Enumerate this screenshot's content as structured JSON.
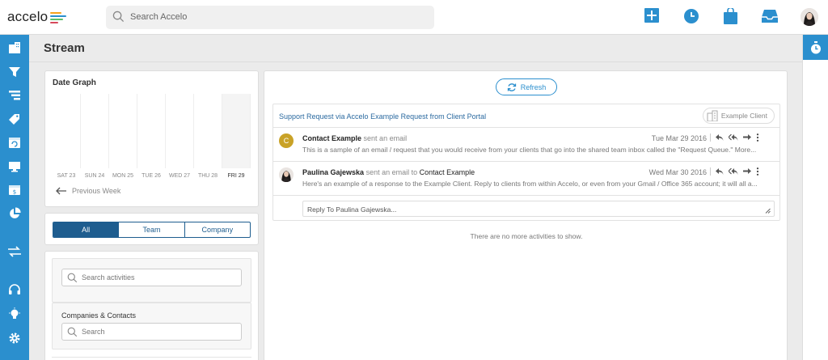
{
  "app": {
    "logo_text": "accelo",
    "search_placeholder": "Search Accelo"
  },
  "page": {
    "title": "Stream"
  },
  "date_graph": {
    "title": "Date Graph",
    "days": [
      "SAT 23",
      "SUN 24",
      "MON 25",
      "TUE 26",
      "WED 27",
      "THU 28",
      "FRI 29"
    ],
    "prev_label": "Previous Week"
  },
  "filter_tabs": [
    "All",
    "Team",
    "Company"
  ],
  "search_activities_placeholder": "Search activities",
  "companies_contacts": {
    "title": "Companies & Contacts",
    "search_placeholder": "Search"
  },
  "stream": {
    "refresh_label": "Refresh",
    "thread_title": "Support Request via Accelo Example Request from Client Portal",
    "client_tag": "Example Client",
    "messages": [
      {
        "avatar_letter": "C",
        "from": "Contact Example",
        "verb": "sent an email",
        "to": "",
        "date": "Tue Mar 29 2016",
        "body": "This is a sample of an email / request that you would receive from your clients that go into the shared team inbox called the \"Request Queue.\" More..."
      },
      {
        "avatar_letter": "",
        "from": "Paulina Gajewska",
        "verb": "sent an email to",
        "to": "Contact Example",
        "date": "Wed Mar 30 2016",
        "body": "Here's an example of a response to the Example Client. Reply to clients from within Accelo, or even from your Gmail / Office 365 account; it will all a..."
      }
    ],
    "reply_placeholder": "Reply To Paulina Gajewska...",
    "no_more": "There are no more activities to show."
  },
  "colors": {
    "brand_blue": "#2b8fce",
    "dark_blue": "#1e5d8f",
    "avatar_gold": "#c9a227"
  }
}
